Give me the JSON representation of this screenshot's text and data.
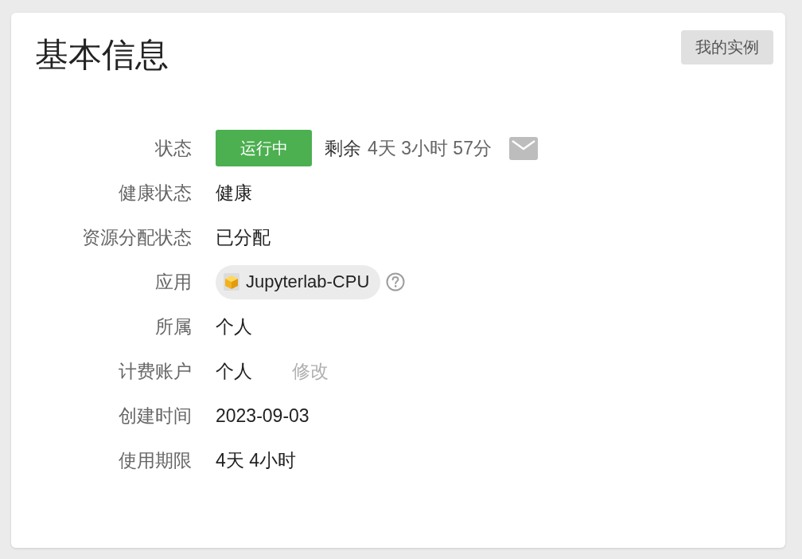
{
  "header": {
    "title": "基本信息",
    "my_instances_button": "我的实例"
  },
  "fields": [
    {
      "kind": "status",
      "label": "状态",
      "status": "运行中",
      "remaining_label": "剩余",
      "remaining": "4天 3小时 57分"
    },
    {
      "kind": "text",
      "label": "健康状态",
      "value": "健康"
    },
    {
      "kind": "text",
      "label": "资源分配状态",
      "value": "已分配"
    },
    {
      "kind": "app",
      "label": "应用",
      "value": "Jupyterlab-CPU"
    },
    {
      "kind": "text",
      "label": "所属",
      "value": "个人"
    },
    {
      "kind": "editable",
      "label": "计费账户",
      "value": "个人",
      "action": "修改",
      "action_disabled": true
    },
    {
      "kind": "text",
      "label": "创建时间",
      "value": "2023-09-03"
    },
    {
      "kind": "text",
      "label": "使用期限",
      "value": "4天 4小时"
    }
  ]
}
